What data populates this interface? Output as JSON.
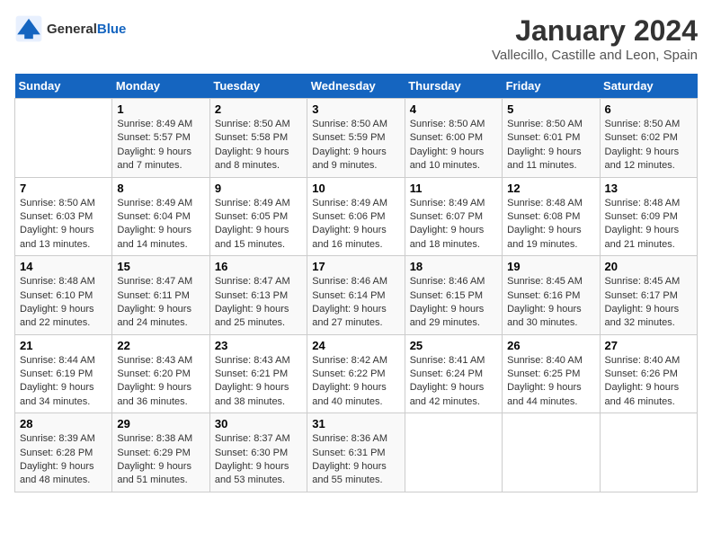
{
  "logo": {
    "general": "General",
    "blue": "Blue"
  },
  "header": {
    "title": "January 2024",
    "subtitle": "Vallecillo, Castille and Leon, Spain"
  },
  "calendar": {
    "weekdays": [
      "Sunday",
      "Monday",
      "Tuesday",
      "Wednesday",
      "Thursday",
      "Friday",
      "Saturday"
    ],
    "weeks": [
      [
        {
          "day": "",
          "sunrise": "",
          "sunset": "",
          "daylight": ""
        },
        {
          "day": "1",
          "sunrise": "Sunrise: 8:49 AM",
          "sunset": "Sunset: 5:57 PM",
          "daylight": "Daylight: 9 hours and 7 minutes."
        },
        {
          "day": "2",
          "sunrise": "Sunrise: 8:50 AM",
          "sunset": "Sunset: 5:58 PM",
          "daylight": "Daylight: 9 hours and 8 minutes."
        },
        {
          "day": "3",
          "sunrise": "Sunrise: 8:50 AM",
          "sunset": "Sunset: 5:59 PM",
          "daylight": "Daylight: 9 hours and 9 minutes."
        },
        {
          "day": "4",
          "sunrise": "Sunrise: 8:50 AM",
          "sunset": "Sunset: 6:00 PM",
          "daylight": "Daylight: 9 hours and 10 minutes."
        },
        {
          "day": "5",
          "sunrise": "Sunrise: 8:50 AM",
          "sunset": "Sunset: 6:01 PM",
          "daylight": "Daylight: 9 hours and 11 minutes."
        },
        {
          "day": "6",
          "sunrise": "Sunrise: 8:50 AM",
          "sunset": "Sunset: 6:02 PM",
          "daylight": "Daylight: 9 hours and 12 minutes."
        }
      ],
      [
        {
          "day": "7",
          "sunrise": "Sunrise: 8:50 AM",
          "sunset": "Sunset: 6:03 PM",
          "daylight": "Daylight: 9 hours and 13 minutes."
        },
        {
          "day": "8",
          "sunrise": "Sunrise: 8:49 AM",
          "sunset": "Sunset: 6:04 PM",
          "daylight": "Daylight: 9 hours and 14 minutes."
        },
        {
          "day": "9",
          "sunrise": "Sunrise: 8:49 AM",
          "sunset": "Sunset: 6:05 PM",
          "daylight": "Daylight: 9 hours and 15 minutes."
        },
        {
          "day": "10",
          "sunrise": "Sunrise: 8:49 AM",
          "sunset": "Sunset: 6:06 PM",
          "daylight": "Daylight: 9 hours and 16 minutes."
        },
        {
          "day": "11",
          "sunrise": "Sunrise: 8:49 AM",
          "sunset": "Sunset: 6:07 PM",
          "daylight": "Daylight: 9 hours and 18 minutes."
        },
        {
          "day": "12",
          "sunrise": "Sunrise: 8:48 AM",
          "sunset": "Sunset: 6:08 PM",
          "daylight": "Daylight: 9 hours and 19 minutes."
        },
        {
          "day": "13",
          "sunrise": "Sunrise: 8:48 AM",
          "sunset": "Sunset: 6:09 PM",
          "daylight": "Daylight: 9 hours and 21 minutes."
        }
      ],
      [
        {
          "day": "14",
          "sunrise": "Sunrise: 8:48 AM",
          "sunset": "Sunset: 6:10 PM",
          "daylight": "Daylight: 9 hours and 22 minutes."
        },
        {
          "day": "15",
          "sunrise": "Sunrise: 8:47 AM",
          "sunset": "Sunset: 6:11 PM",
          "daylight": "Daylight: 9 hours and 24 minutes."
        },
        {
          "day": "16",
          "sunrise": "Sunrise: 8:47 AM",
          "sunset": "Sunset: 6:13 PM",
          "daylight": "Daylight: 9 hours and 25 minutes."
        },
        {
          "day": "17",
          "sunrise": "Sunrise: 8:46 AM",
          "sunset": "Sunset: 6:14 PM",
          "daylight": "Daylight: 9 hours and 27 minutes."
        },
        {
          "day": "18",
          "sunrise": "Sunrise: 8:46 AM",
          "sunset": "Sunset: 6:15 PM",
          "daylight": "Daylight: 9 hours and 29 minutes."
        },
        {
          "day": "19",
          "sunrise": "Sunrise: 8:45 AM",
          "sunset": "Sunset: 6:16 PM",
          "daylight": "Daylight: 9 hours and 30 minutes."
        },
        {
          "day": "20",
          "sunrise": "Sunrise: 8:45 AM",
          "sunset": "Sunset: 6:17 PM",
          "daylight": "Daylight: 9 hours and 32 minutes."
        }
      ],
      [
        {
          "day": "21",
          "sunrise": "Sunrise: 8:44 AM",
          "sunset": "Sunset: 6:19 PM",
          "daylight": "Daylight: 9 hours and 34 minutes."
        },
        {
          "day": "22",
          "sunrise": "Sunrise: 8:43 AM",
          "sunset": "Sunset: 6:20 PM",
          "daylight": "Daylight: 9 hours and 36 minutes."
        },
        {
          "day": "23",
          "sunrise": "Sunrise: 8:43 AM",
          "sunset": "Sunset: 6:21 PM",
          "daylight": "Daylight: 9 hours and 38 minutes."
        },
        {
          "day": "24",
          "sunrise": "Sunrise: 8:42 AM",
          "sunset": "Sunset: 6:22 PM",
          "daylight": "Daylight: 9 hours and 40 minutes."
        },
        {
          "day": "25",
          "sunrise": "Sunrise: 8:41 AM",
          "sunset": "Sunset: 6:24 PM",
          "daylight": "Daylight: 9 hours and 42 minutes."
        },
        {
          "day": "26",
          "sunrise": "Sunrise: 8:40 AM",
          "sunset": "Sunset: 6:25 PM",
          "daylight": "Daylight: 9 hours and 44 minutes."
        },
        {
          "day": "27",
          "sunrise": "Sunrise: 8:40 AM",
          "sunset": "Sunset: 6:26 PM",
          "daylight": "Daylight: 9 hours and 46 minutes."
        }
      ],
      [
        {
          "day": "28",
          "sunrise": "Sunrise: 8:39 AM",
          "sunset": "Sunset: 6:28 PM",
          "daylight": "Daylight: 9 hours and 48 minutes."
        },
        {
          "day": "29",
          "sunrise": "Sunrise: 8:38 AM",
          "sunset": "Sunset: 6:29 PM",
          "daylight": "Daylight: 9 hours and 51 minutes."
        },
        {
          "day": "30",
          "sunrise": "Sunrise: 8:37 AM",
          "sunset": "Sunset: 6:30 PM",
          "daylight": "Daylight: 9 hours and 53 minutes."
        },
        {
          "day": "31",
          "sunrise": "Sunrise: 8:36 AM",
          "sunset": "Sunset: 6:31 PM",
          "daylight": "Daylight: 9 hours and 55 minutes."
        },
        {
          "day": "",
          "sunrise": "",
          "sunset": "",
          "daylight": ""
        },
        {
          "day": "",
          "sunrise": "",
          "sunset": "",
          "daylight": ""
        },
        {
          "day": "",
          "sunrise": "",
          "sunset": "",
          "daylight": ""
        }
      ]
    ]
  }
}
